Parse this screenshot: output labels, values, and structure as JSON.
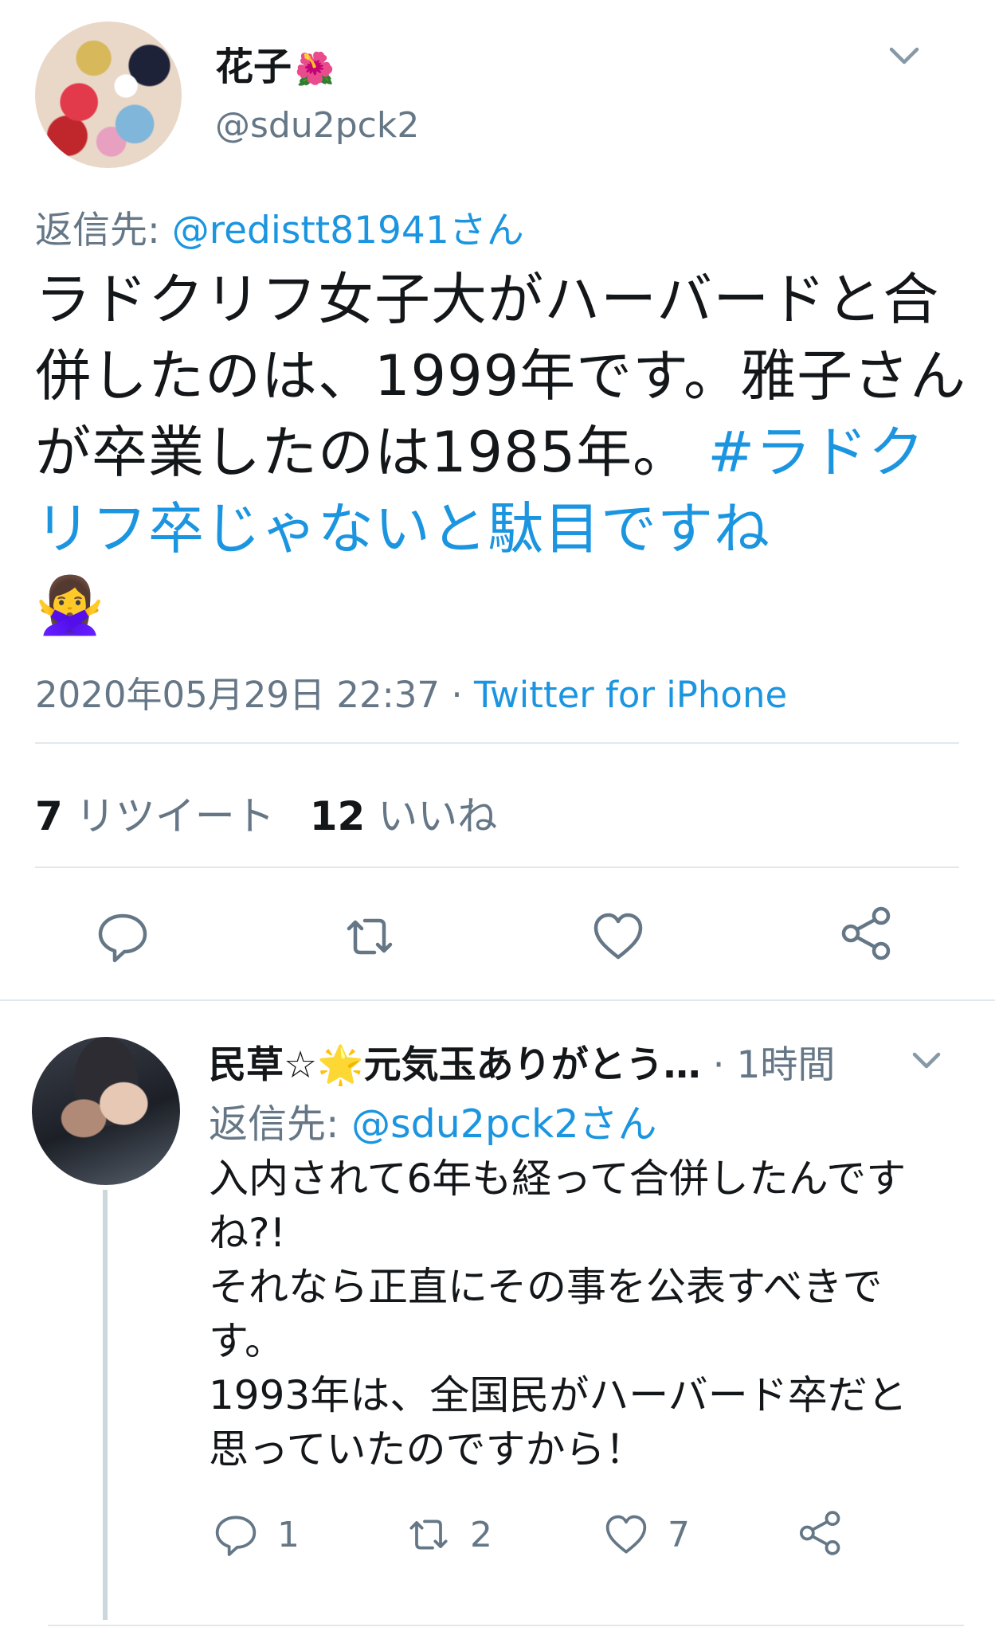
{
  "main_tweet": {
    "display_name": "花子",
    "name_emoji": "🌺",
    "handle": "@sdu2pck2",
    "reply_to_prefix": "返信先: ",
    "reply_to_handle": "@redistt81941さん",
    "body_text": "ラドクリフ女子大がハーバードと合併したのは、1999年です。雅子さんが卒業したのは1985年。 ",
    "hashtag": "#ラドクリフ卒じゃないと駄目ですね",
    "emoji": "🙅‍♀️",
    "timestamp": "2020年05月29日 22:37",
    "separator": " · ",
    "source": "Twitter for iPhone",
    "retweet_count": "7",
    "retweet_label": "リツイート",
    "like_count": "12",
    "like_label": "いいね"
  },
  "reply_tweet": {
    "display_name": "民草☆🌟元気玉ありがとう…",
    "time_separator": " · ",
    "time": "1時間",
    "reply_to_prefix": "返信先: ",
    "reply_to_handle": "@sdu2pck2さん",
    "body_text": "入内されて6年も経って合併したんです\nね?!\nそれなら正直にその事を公表すべきで\nす。\n1993年は、全国民がハーバード卒だと\n思っていたのですから！",
    "reply_count": "1",
    "retweet_count": "2",
    "like_count": "7"
  },
  "icons": {
    "reply": "reply-icon",
    "retweet": "retweet-icon",
    "like": "heart-icon",
    "share": "share-icon",
    "chevron": "chevron-down-icon"
  },
  "colors": {
    "link": "#1b95e0",
    "secondary_text": "#657786",
    "primary_text": "#14171a",
    "divider": "#e1e8ed"
  }
}
